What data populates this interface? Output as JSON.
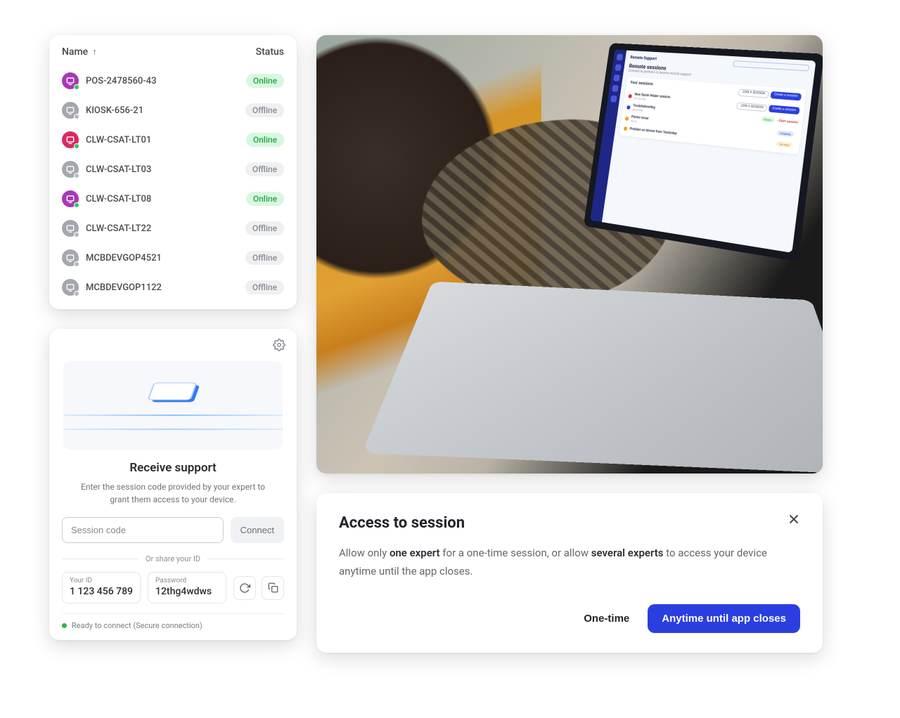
{
  "device_list": {
    "col_name": "Name",
    "col_status": "Status",
    "rows": [
      {
        "name": "POS-2478560-43",
        "status": "Online",
        "iconColor": "ic-purple",
        "dot": "dot-online"
      },
      {
        "name": "KIOSK-656-21",
        "status": "Offline",
        "iconColor": "ic-gray",
        "dot": "dot-offline"
      },
      {
        "name": "CLW-CSAT-LT01",
        "status": "Online",
        "iconColor": "ic-pink",
        "dot": "dot-online"
      },
      {
        "name": "CLW-CSAT-LT03",
        "status": "Offline",
        "iconColor": "ic-gray",
        "dot": "dot-offline"
      },
      {
        "name": "CLW-CSAT-LT08",
        "status": "Online",
        "iconColor": "ic-purple",
        "dot": "dot-online"
      },
      {
        "name": "CLW-CSAT-LT22",
        "status": "Offline",
        "iconColor": "ic-gray",
        "dot": "dot-offline"
      },
      {
        "name": "MCBDEVGOP4521",
        "status": "Offline",
        "iconColor": "ic-gray",
        "dot": "dot-offline"
      },
      {
        "name": "MCBDEVGOP1122",
        "status": "Offline",
        "iconColor": "ic-gray",
        "dot": "dot-offline"
      }
    ]
  },
  "support": {
    "title": "Receive support",
    "description": "Enter the session code provided by your expert to grant them access to your device.",
    "code_placeholder": "Session code",
    "connect": "Connect",
    "or_text": "Or share your ID",
    "id_label": "Your ID",
    "id_value": "1 123 456 789",
    "pw_label": "Password",
    "pw_value": "12thg4wdws",
    "ready_text": "Ready to connect (Secure connection)"
  },
  "laptop": {
    "header": "Remote Support",
    "title": "Remote sessions",
    "subtitle": "Connect to partners or receive remote support",
    "section": "Your sessions",
    "join_btn": "JOIN A SESSION",
    "create_btn": "Create a session",
    "start_link": "Start session",
    "rows": [
      {
        "t1": "New Quick Helper session",
        "t2": "ID 123 456",
        "chip": "",
        "chipClass": ""
      },
      {
        "t1": "Troubleshooting",
        "t2": "09:35 PM",
        "chip": "Ready",
        "chipClass": "chip-green"
      },
      {
        "t1": "Printer issue",
        "t2": "09:24",
        "chip": "Ongoing",
        "chipClass": "chip-blue"
      },
      {
        "t1": "Problem on device from Yesterday",
        "t2": "",
        "chip": "On hold",
        "chipClass": "chip-yel"
      }
    ]
  },
  "access": {
    "title": "Access to session",
    "desc_pre": "Allow only ",
    "desc_bold1": "one expert",
    "desc_mid1": " for a one-time session, or allow ",
    "desc_bold2": "several experts",
    "desc_mid2": " to access your device anytime until the app closes.",
    "btn_one": "One-time",
    "btn_any": "Anytime until app closes"
  }
}
